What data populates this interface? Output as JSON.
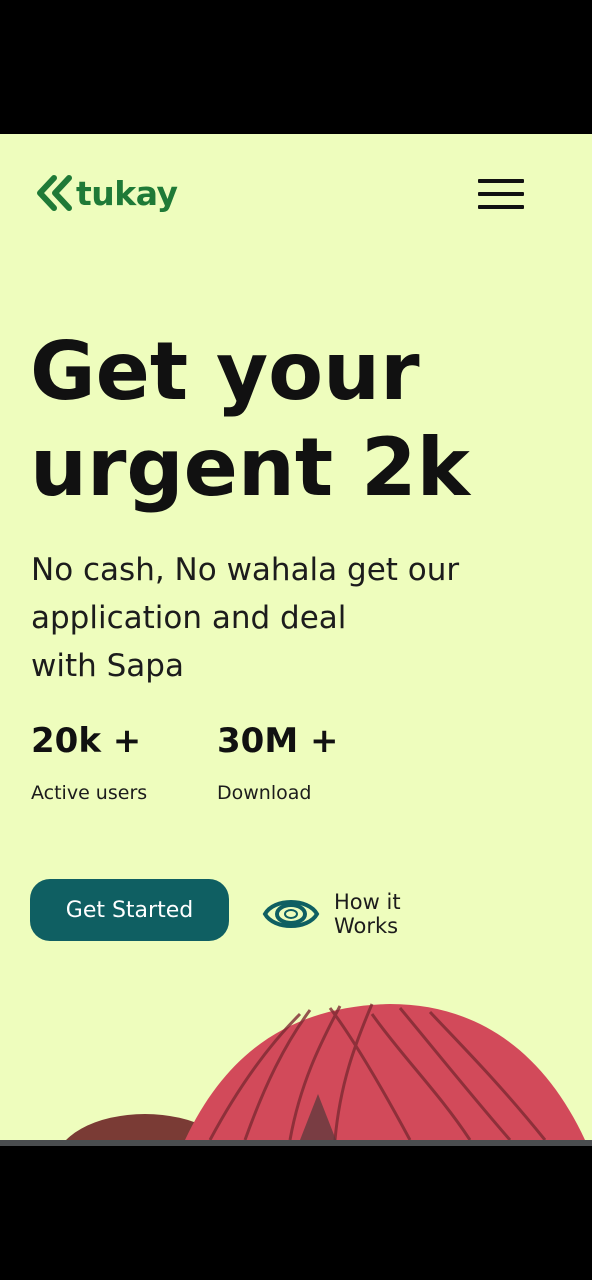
{
  "header": {
    "logo_text": "tukay",
    "menu_icon": "hamburger-menu-icon"
  },
  "hero": {
    "headline_line1": "Get your",
    "headline_line2": "urgent 2k",
    "subtitle_line1": "No cash, No wahala get our",
    "subtitle_line2": "application and deal",
    "subtitle_line3": "with Sapa"
  },
  "stats": [
    {
      "value": "20k +",
      "label": "Active users"
    },
    {
      "value": "30M +",
      "label": "Download"
    }
  ],
  "actions": {
    "primary_label": "Get Started",
    "secondary_line1": "How it",
    "secondary_line2": "Works",
    "secondary_icon": "eye-icon"
  },
  "colors": {
    "background": "#eefdbd",
    "brand_green": "#1f7a37",
    "button": "#0f5f62",
    "illustration_red": "#d24a5a"
  }
}
